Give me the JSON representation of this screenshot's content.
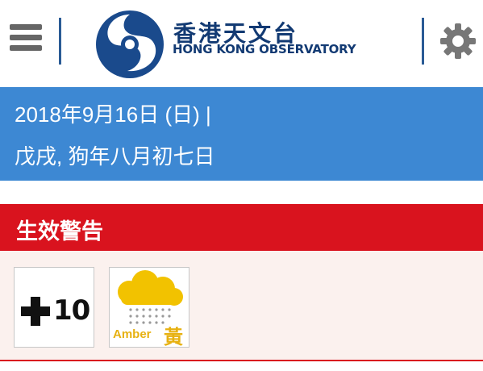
{
  "header": {
    "title_cn": "香港天文台",
    "title_en": "HONG KONG OBSERVATORY",
    "menu_icon": "hamburger-icon",
    "settings_icon": "gear-icon"
  },
  "date": {
    "gregorian": "2018年9月16日 (日)  |",
    "lunar": "戊戌, 狗年八月初七日"
  },
  "warnings": {
    "heading": "生效警告",
    "items": [
      {
        "name": "tropical-cyclone-signal-10",
        "label": "10"
      },
      {
        "name": "amber-rainstorm",
        "label_en": "Amber",
        "label_cn": "黃"
      }
    ]
  },
  "colors": {
    "brand_blue": "#123a73",
    "date_band": "#3d88d3",
    "warning_red": "#d9131e",
    "amber": "#e7b111"
  }
}
